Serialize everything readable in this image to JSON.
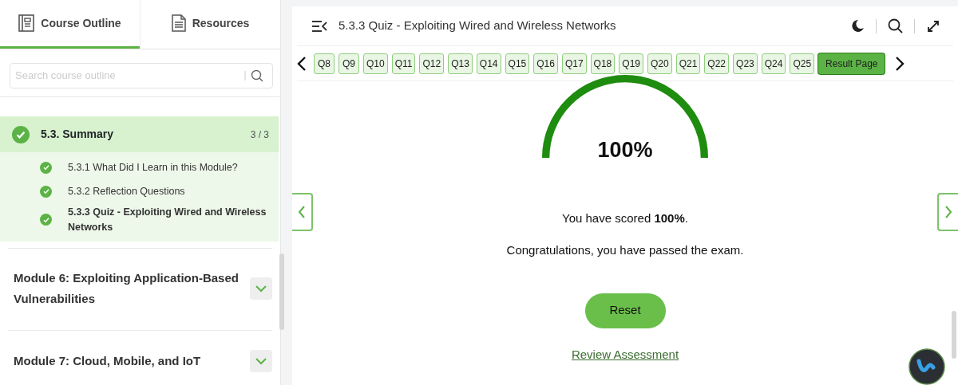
{
  "sidebar": {
    "tabs": [
      {
        "label": "Course Outline",
        "kind": "outline",
        "selected": true
      },
      {
        "label": "Resources",
        "kind": "doc",
        "selected": false
      }
    ],
    "search": {
      "placeholder": "Search course outline"
    },
    "section": {
      "title": "5.3. Summary",
      "count": "3 / 3",
      "completed": true,
      "items": [
        {
          "label": "5.3.1 What Did I Learn in this Module?",
          "completed": true,
          "selected": false
        },
        {
          "label": "5.3.2 Reflection Questions",
          "completed": true,
          "selected": false
        },
        {
          "label": "5.3.3 Quiz - Exploiting Wired and Wireless Networks",
          "completed": true,
          "selected": true
        }
      ]
    },
    "modules": [
      {
        "title": "Module 6: Exploiting Application-Based Vulnerabilities",
        "expanded": false
      },
      {
        "title": "Module 7: Cloud, Mobile, and IoT",
        "expanded": false
      }
    ]
  },
  "header": {
    "title": "5.3.3 Quiz - Exploiting Wired and Wireless Networks"
  },
  "questions": [
    {
      "label": "Q8",
      "kind": "question",
      "selected": false
    },
    {
      "label": "Q9",
      "kind": "question",
      "selected": false
    },
    {
      "label": "Q10",
      "kind": "question",
      "selected": false
    },
    {
      "label": "Q11",
      "kind": "question",
      "selected": false
    },
    {
      "label": "Q12",
      "kind": "question",
      "selected": false
    },
    {
      "label": "Q13",
      "kind": "question",
      "selected": false
    },
    {
      "label": "Q14",
      "kind": "question",
      "selected": false
    },
    {
      "label": "Q15",
      "kind": "question",
      "selected": false
    },
    {
      "label": "Q16",
      "kind": "question",
      "selected": false
    },
    {
      "label": "Q17",
      "kind": "question",
      "selected": false
    },
    {
      "label": "Q18",
      "kind": "question",
      "selected": false
    },
    {
      "label": "Q19",
      "kind": "question",
      "selected": false
    },
    {
      "label": "Q20",
      "kind": "question",
      "selected": false
    },
    {
      "label": "Q21",
      "kind": "question",
      "selected": false
    },
    {
      "label": "Q22",
      "kind": "question",
      "selected": false
    },
    {
      "label": "Q23",
      "kind": "question",
      "selected": false
    },
    {
      "label": "Q24",
      "kind": "question",
      "selected": false
    },
    {
      "label": "Q25",
      "kind": "question",
      "selected": false
    },
    {
      "label": "Result Page",
      "kind": "result",
      "selected": true
    }
  ],
  "result": {
    "level": 1.0,
    "percent": "100%",
    "score_text": "You have scored **100%**.",
    "message": "Congratulations, you have passed the exam.",
    "reset": "Reset",
    "review": "Review Assessment"
  }
}
